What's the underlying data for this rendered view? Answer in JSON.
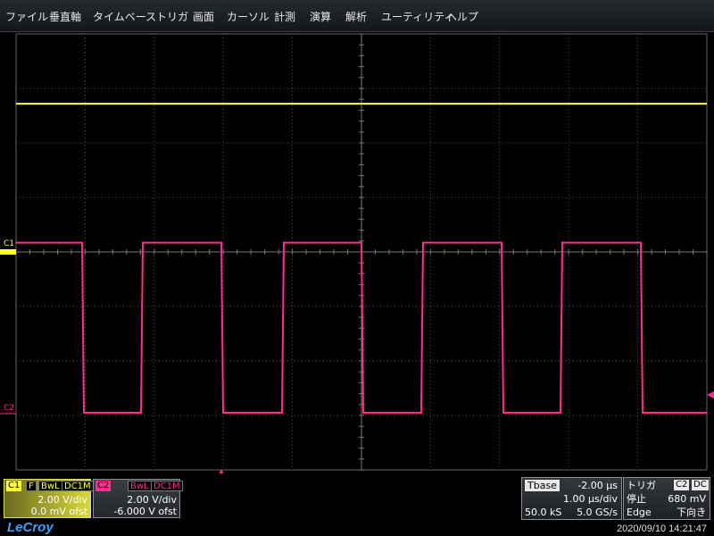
{
  "menu": {
    "items": [
      "ファイル",
      "垂直軸",
      "タイムベース",
      "トリガ",
      "画面",
      "カーソル",
      "計測",
      "演算",
      "解析",
      "ユーティリティ",
      "ヘルプ"
    ]
  },
  "scope": {
    "c1_marker": "C1",
    "c2_marker": "C2",
    "colors": {
      "c1": "#ffff33",
      "c2": "#ff2d8c",
      "grid": "#555555"
    }
  },
  "c1_panel": {
    "name": "C1",
    "tag_f": "F",
    "tag_bwl": "BwL",
    "tag_coupling": "DC1M",
    "vdiv": "2.00 V/div",
    "offset": "0.0 mV ofst"
  },
  "c2_panel": {
    "name": "C2",
    "tag_bwl": "BwL",
    "tag_coupling": "DC1M",
    "vdiv": "2.00 V/div",
    "offset": "-6.000 V ofst"
  },
  "timebase": {
    "label": "Tbase",
    "delay": "-2.00 µs",
    "tdiv": "1.00 µs/div",
    "samples": "50.0 kS",
    "rate": "5.0 GS/s"
  },
  "trigger": {
    "label": "トリガ",
    "source": "C2",
    "coupling": "DC",
    "mode": "停止",
    "level": "680 mV",
    "type": "Edge",
    "slope": "下向き"
  },
  "footer": {
    "logo": "LeCroy",
    "timestamp": "2020/09/10 14:21:47"
  }
}
